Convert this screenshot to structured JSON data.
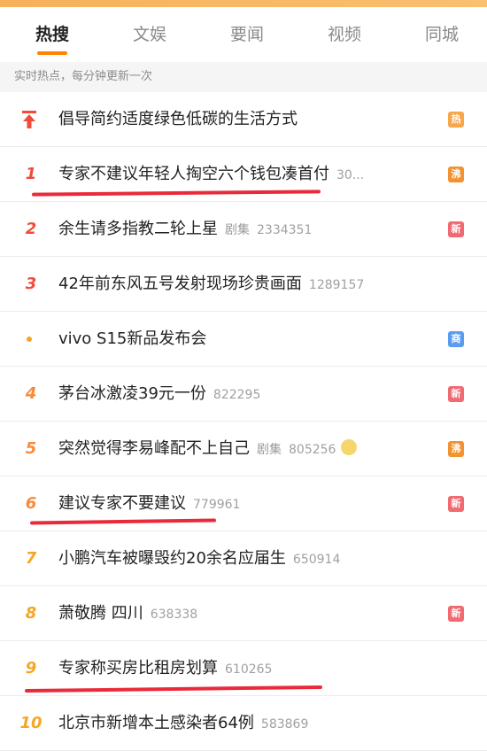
{
  "tabs": [
    {
      "label": "热搜",
      "active": true
    },
    {
      "label": "文娱",
      "active": false
    },
    {
      "label": "要闻",
      "active": false
    },
    {
      "label": "视频",
      "active": false
    },
    {
      "label": "同城",
      "active": false
    }
  ],
  "notice": "实时热点，每分钟更新一次",
  "list": {
    "pinned": {
      "title": "倡导简约适度绿色低碳的生活方式",
      "badge": "热"
    },
    "items": [
      {
        "rank": "1",
        "title": "专家不建议年轻人掏空六个钱包凑首付",
        "count": "30...",
        "badge": "沸"
      },
      {
        "rank": "2",
        "title": "余生请多指教二轮上星",
        "tag": "剧集",
        "count": "2334351",
        "badge": "新"
      },
      {
        "rank": "3",
        "title": "42年前东风五号发射现场珍贵画面",
        "count": "1289157"
      },
      {
        "rank": "",
        "title": "vivo S15新品发布会",
        "badge": "商"
      },
      {
        "rank": "4",
        "title": "茅台冰激凌39元一份",
        "count": "822295",
        "badge": "新"
      },
      {
        "rank": "5",
        "title": "突然觉得李易峰配不上自己",
        "tag": "剧集",
        "count": "805256",
        "badge": "沸"
      },
      {
        "rank": "6",
        "title": "建议专家不要建议",
        "count": "779961",
        "badge": "新"
      },
      {
        "rank": "7",
        "title": "小鹏汽车被曝毁约20余名应届生",
        "count": "650914"
      },
      {
        "rank": "8",
        "title": "萧敬腾 四川",
        "count": "638338",
        "badge": "新"
      },
      {
        "rank": "9",
        "title": "专家称买房比租房划算",
        "count": "610265"
      },
      {
        "rank": "10",
        "title": "北京市新增本土感染者64例",
        "count": "583869"
      }
    ]
  },
  "colors": {
    "accent": "#ff8200",
    "underline": "#ea2a3a",
    "rank_hot": "#f04b3b"
  }
}
